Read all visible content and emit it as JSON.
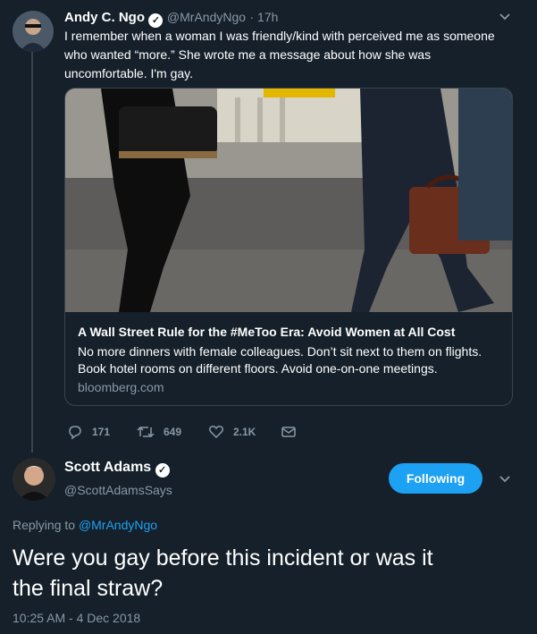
{
  "original_tweet": {
    "author_name": "Andy C. Ngo",
    "handle": "@MrAndyNgo",
    "time": "· 17h",
    "text_lines": [
      "I remember when a woman I was friendly/kind with perceived me as someone",
      "who wanted “more.” She wrote me a message about how she was",
      "uncomfortable. I'm gay."
    ],
    "card": {
      "title": "A Wall Street Rule for the #MeToo Era: Avoid Women at All Cost",
      "description_lines": [
        "No more dinners with female colleagues. Don’t sit next to them on flights.",
        "Book hotel rooms on different floors. Avoid one-on-one meetings."
      ],
      "domain": "bloomberg.com"
    },
    "actions": {
      "replies": "171",
      "retweets": "649",
      "likes": "2.1K"
    }
  },
  "reply_tweet": {
    "author_name": "Scott Adams",
    "handle": "@ScottAdamsSays",
    "follow_label": "Following",
    "replying_to_prefix": "Replying to",
    "replying_to_handle": "@MrAndyNgo",
    "text_lines": [
      "Were you gay before this incident or was it",
      "the final straw?"
    ],
    "timestamp": "10:25 AM - 4 Dec 2018"
  },
  "colors": {
    "background": "#15202b",
    "accent": "#1da1f2",
    "muted_text": "#8899a6",
    "border": "#38444d"
  }
}
